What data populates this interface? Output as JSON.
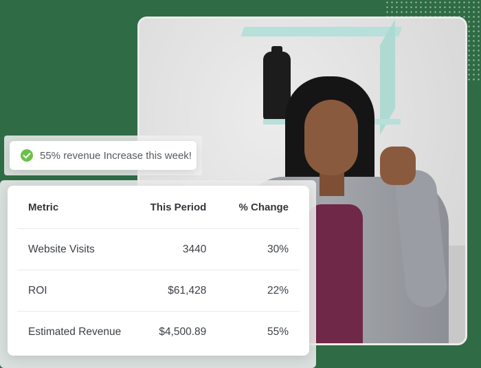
{
  "notification": {
    "text": "55% revenue Increase this week!",
    "icon": "check-circle-icon",
    "icon_color": "#6cc04a"
  },
  "table": {
    "headers": [
      "Metric",
      "This Period",
      "% Change"
    ],
    "rows": [
      {
        "metric": "Website Visits",
        "value": "3440",
        "change": "30%"
      },
      {
        "metric": "ROI",
        "value": "$61,428",
        "change": "22%"
      },
      {
        "metric": "Estimated Revenue",
        "value": "$4,500.89",
        "change": "55%"
      }
    ]
  },
  "colors": {
    "background": "#2f6b45",
    "accent_green": "#6cc04a"
  }
}
